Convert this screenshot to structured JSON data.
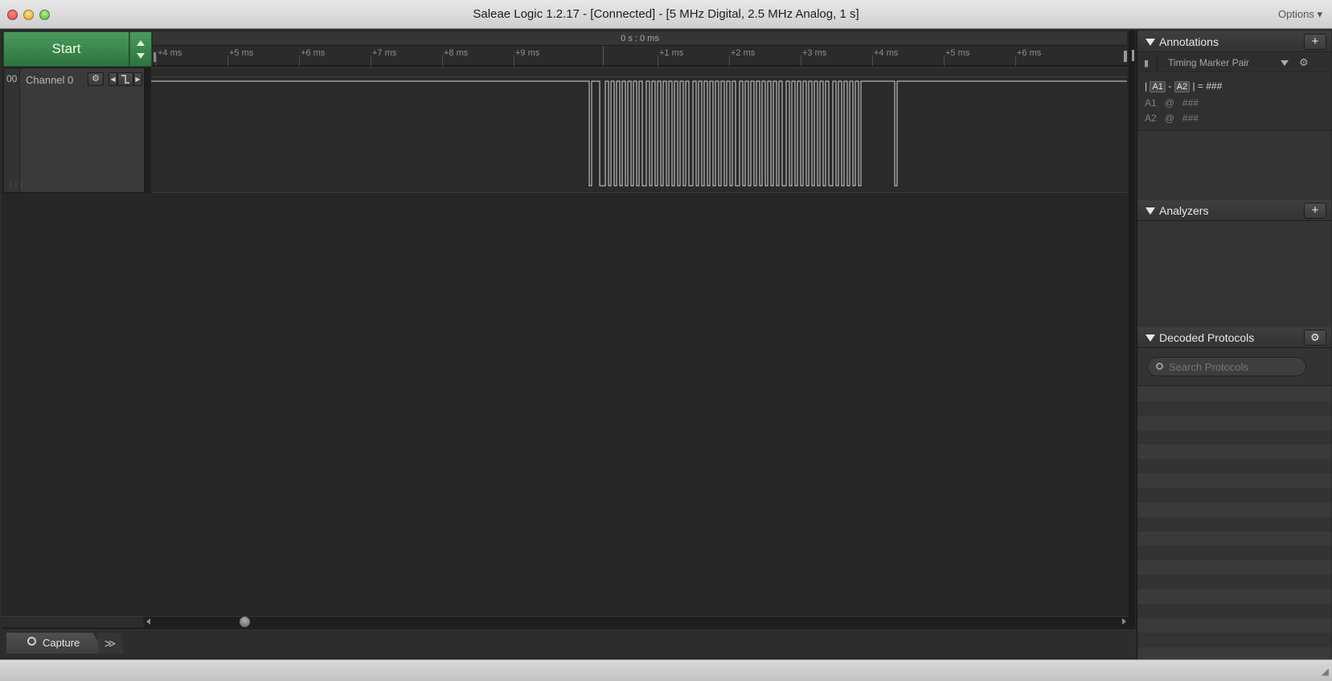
{
  "window": {
    "title": "Saleae Logic 1.2.17 - [Connected] - [5 MHz Digital, 2.5 MHz Analog, 1 s]",
    "options_label": "Options ▾"
  },
  "toolbar": {
    "start_label": "Start",
    "accent_color": "#3a8a4c"
  },
  "ruler": {
    "center_label": "0 s : 0 ms",
    "ticks": [
      "+4 ms",
      "+5 ms",
      "+6 ms",
      "+7 ms",
      "+8 ms",
      "+9 ms",
      "+1 ms",
      "+2 ms",
      "+3 ms",
      "+4 ms",
      "+5 ms",
      "+6 ms"
    ]
  },
  "channels": [
    {
      "number": "00",
      "name": "Channel 0",
      "trigger_icon": "falling-edge-icon"
    }
  ],
  "tabs": {
    "capture_label": "Capture",
    "more_label": "≫"
  },
  "sidebar": {
    "annotations": {
      "title": "Annotations",
      "add_label": "+",
      "type_label": "Timing Marker Pair",
      "formula_open": "|",
      "a1": "A1",
      "minus": "-",
      "a2": "A2",
      "formula_close": "| =",
      "formula_value": "###",
      "rows": [
        {
          "label": "A1",
          "at": "@",
          "value": "###"
        },
        {
          "label": "A2",
          "at": "@",
          "value": "###"
        }
      ]
    },
    "analyzers": {
      "title": "Analyzers",
      "add_label": "+"
    },
    "decoded_protocols": {
      "title": "Decoded Protocols",
      "search_placeholder": "Search Protocols"
    }
  }
}
